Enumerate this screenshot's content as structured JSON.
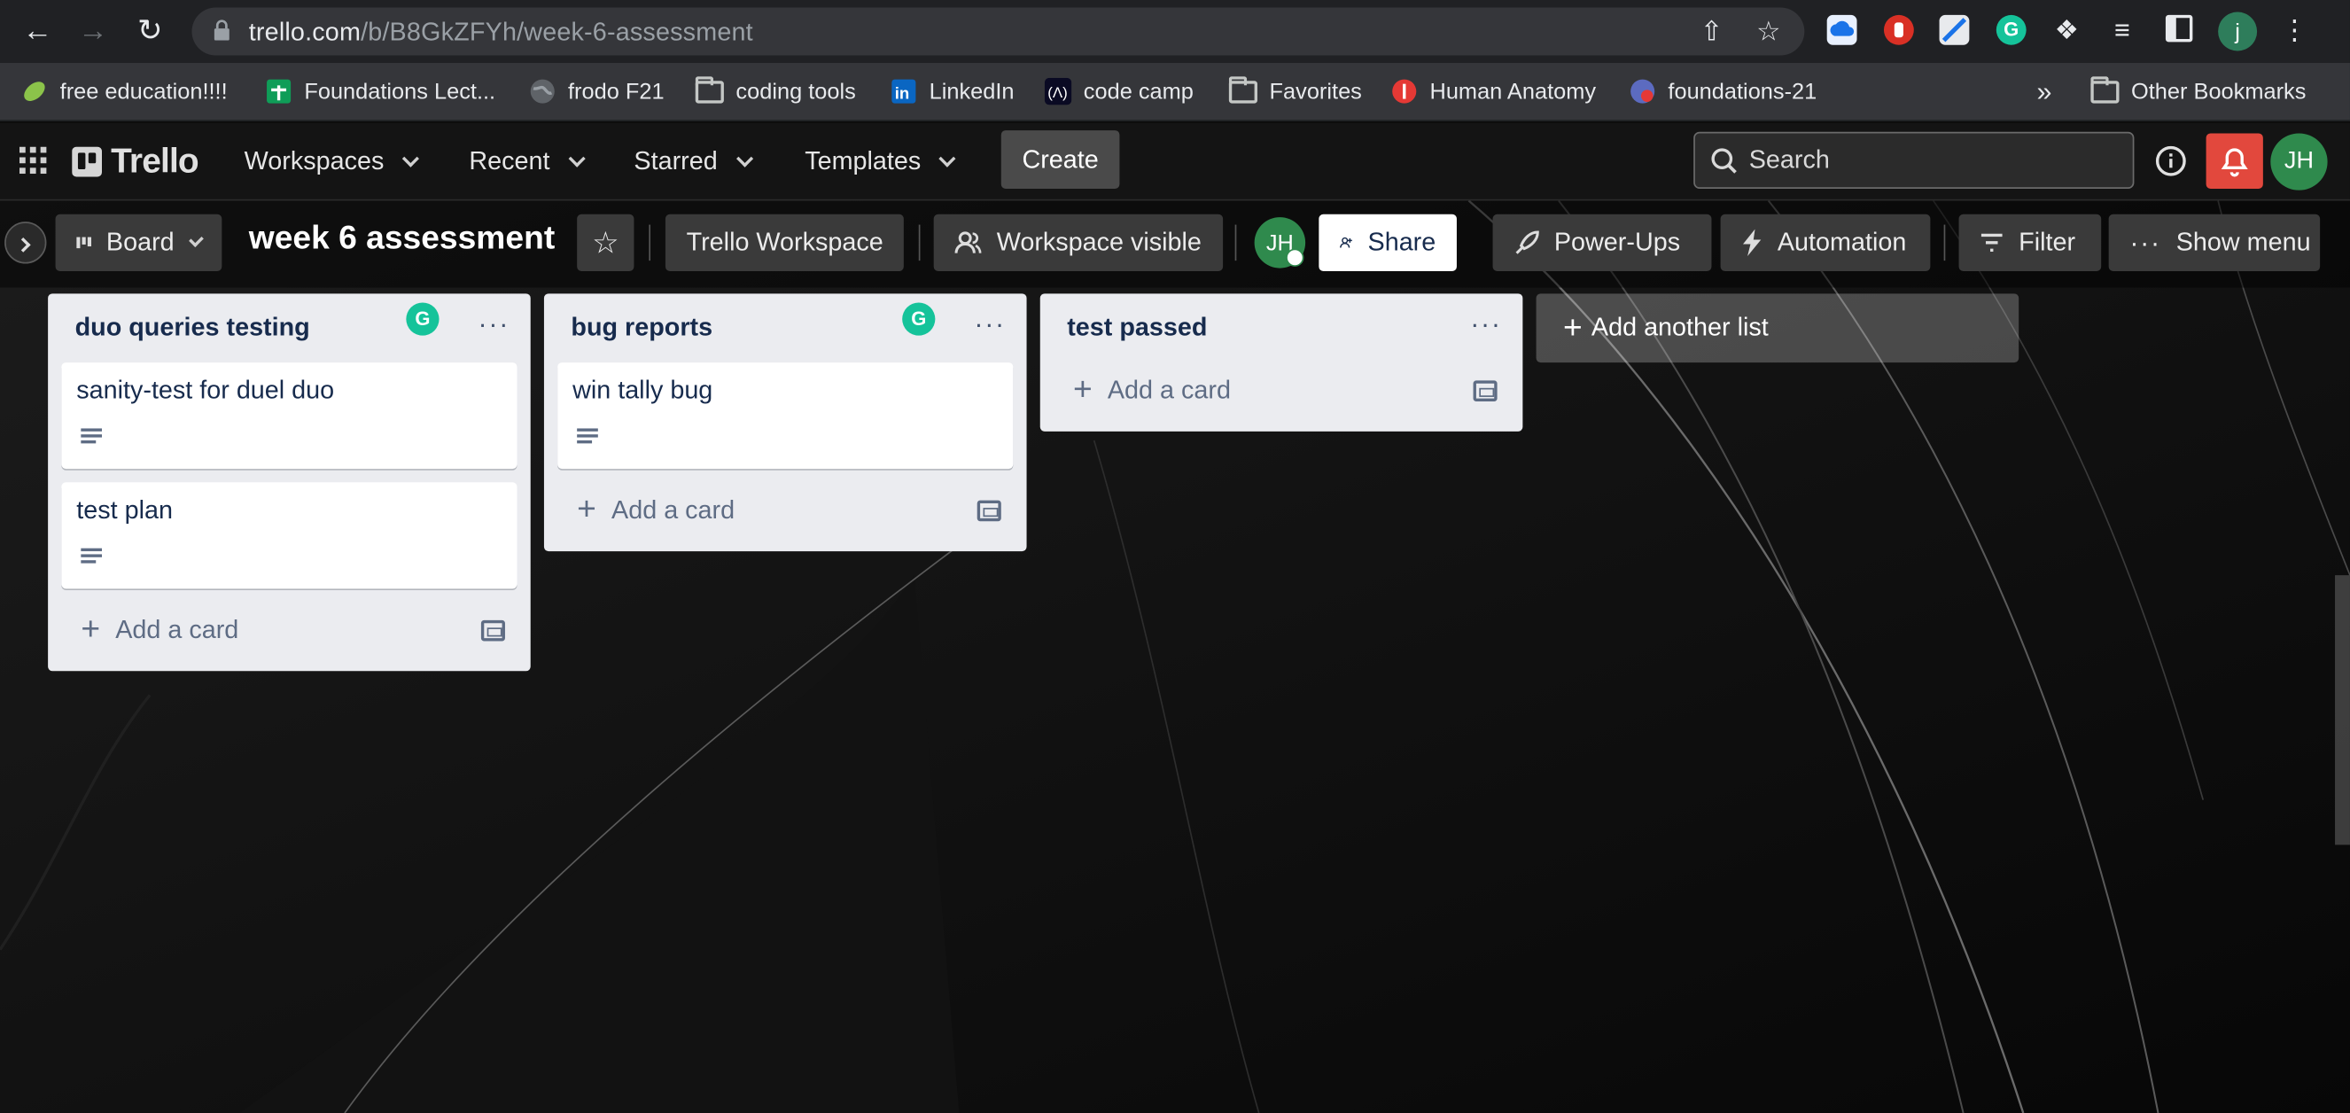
{
  "browser": {
    "url_host": "trello.com",
    "url_path": "/b/B8GkZFYh/week-6-assessment",
    "profile_initial": "j",
    "bookmarks": [
      {
        "label": "free education!!!!",
        "icon": "leaf-icon",
        "color": "#8bc34a"
      },
      {
        "label": "Foundations Lect...",
        "icon": "sheets-icon",
        "color": "#0f9d58"
      },
      {
        "label": "frodo F21",
        "icon": "globe-icon",
        "color": "#9aa0a6"
      },
      {
        "label": "coding tools",
        "icon": "folder-icon",
        "color": "#c4c7c5"
      },
      {
        "label": "LinkedIn",
        "icon": "linkedin-icon",
        "color": "#0a66c2"
      },
      {
        "label": "code camp",
        "icon": "freecodecamp-icon",
        "color": "#0a0a23"
      },
      {
        "label": "Favorites",
        "icon": "folder-icon",
        "color": "#c4c7c5"
      },
      {
        "label": "Human Anatomy",
        "icon": "anatomy-icon",
        "color": "#e53935"
      },
      {
        "label": "foundations-21",
        "icon": "app-icon",
        "color": "#5c6bc0"
      }
    ],
    "overflow": "»",
    "other_bookmarks": "Other Bookmarks"
  },
  "trello": {
    "logo": "Trello",
    "nav": [
      "Workspaces",
      "Recent",
      "Starred",
      "Templates"
    ],
    "create": "Create",
    "search_placeholder": "Search",
    "user_initials": "JH",
    "notification_color": "#e2483d"
  },
  "board": {
    "view": "Board",
    "title": "week 6 assessment",
    "workspace": "Trello Workspace",
    "visibility": "Workspace visible",
    "member_initials": "JH",
    "share": "Share",
    "powerups": "Power-Ups",
    "automation": "Automation",
    "filter": "Filter",
    "show_menu": "Show menu"
  },
  "lists": [
    {
      "title": "duo queries testing",
      "cards": [
        "sanity-test for duel duo",
        "test plan"
      ],
      "add_card": "Add a card"
    },
    {
      "title": "bug reports",
      "cards": [
        "win tally bug"
      ],
      "add_card": "Add a card"
    },
    {
      "title": "test passed",
      "cards": [],
      "add_card": "Add a card"
    }
  ],
  "add_another_list": "Add another list",
  "grammarly_letter": "G",
  "list_menu_glyph": "···"
}
